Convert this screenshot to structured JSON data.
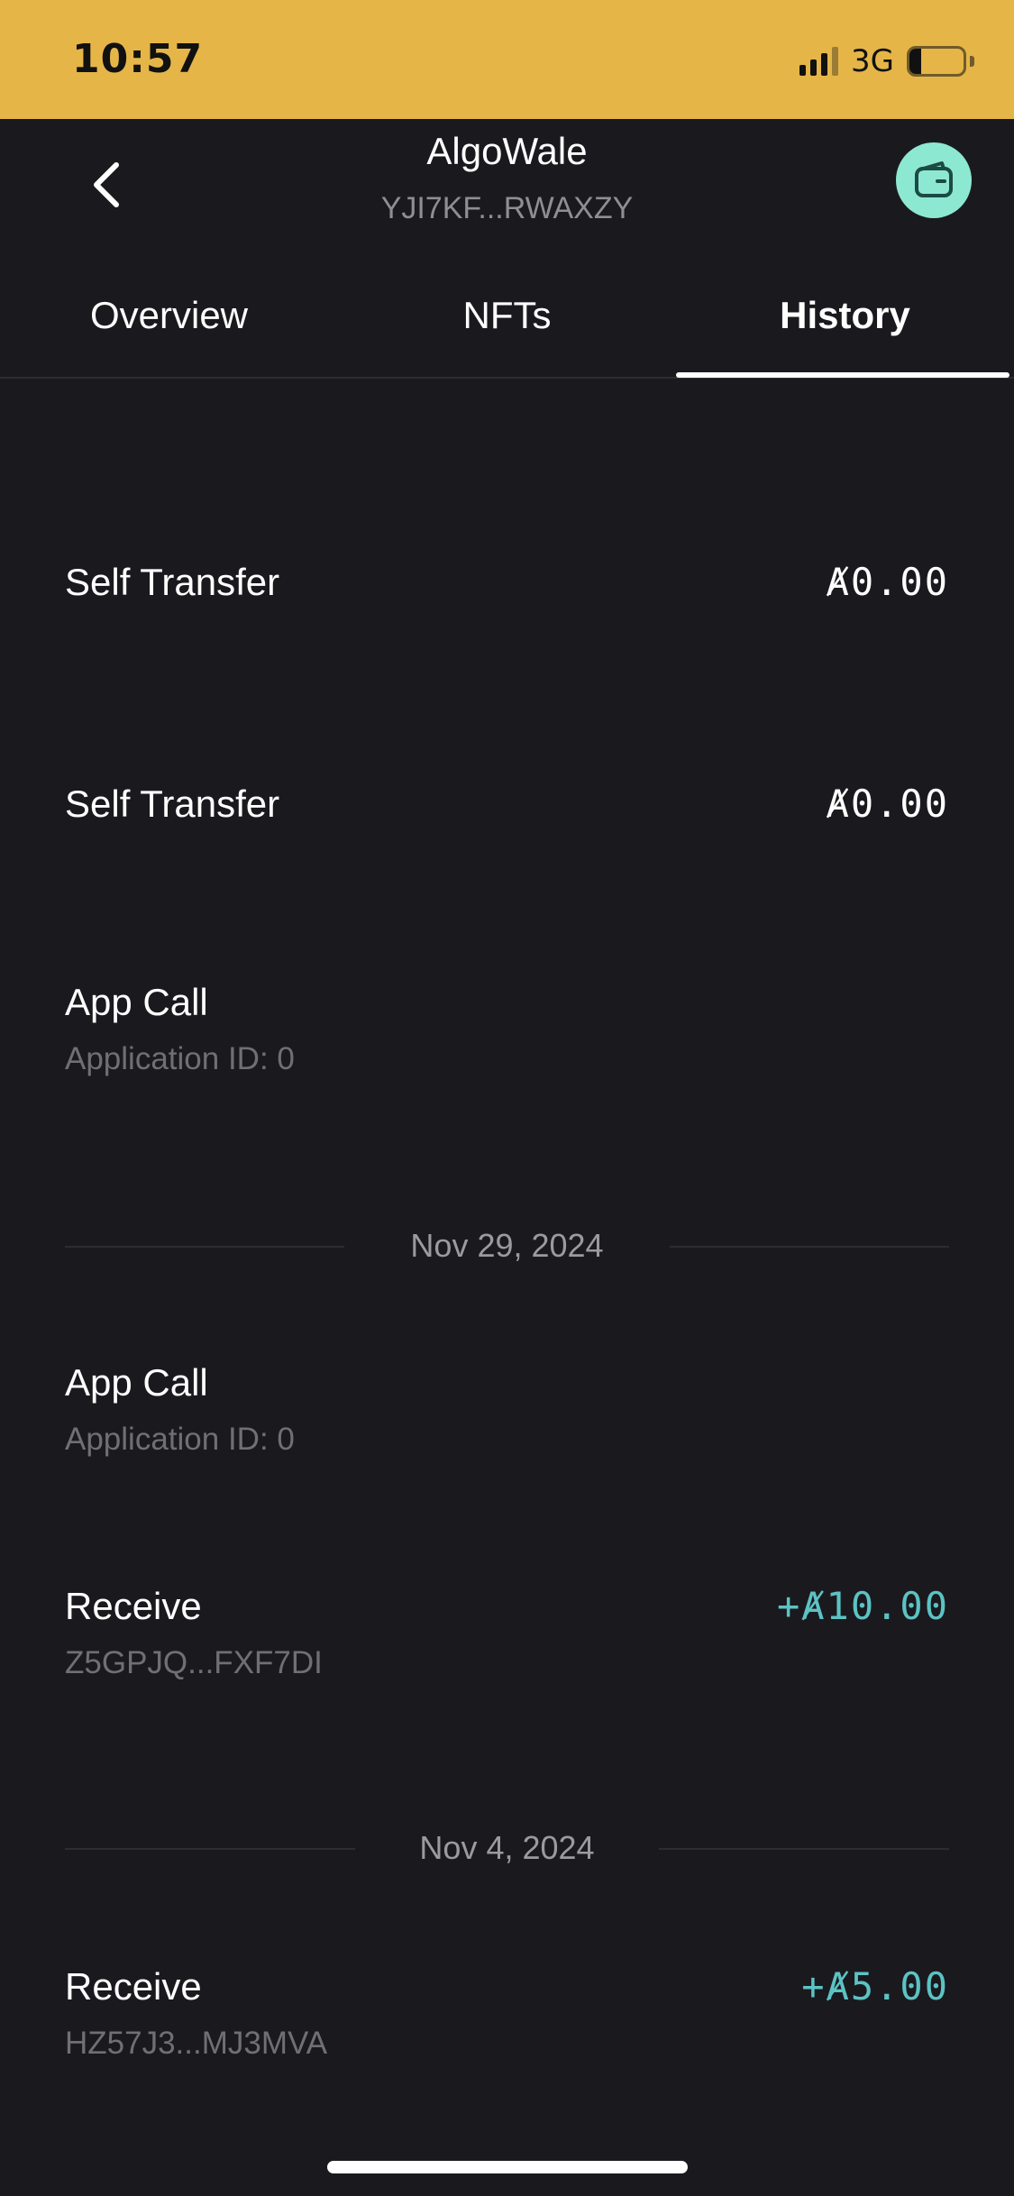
{
  "status_bar": {
    "time": "10:57",
    "network": "3G",
    "battery": "22",
    "battery_level": 0.22,
    "background_color": "#e5b548"
  },
  "header": {
    "title": "AlgoWale",
    "subtitle": "YJI7KF...RWAXZY",
    "back_icon": "chevron-left-icon",
    "wallet_icon": "wallet-icon",
    "wallet_button_color": "#8de8d2"
  },
  "tabs": [
    {
      "label": "Overview",
      "active": false
    },
    {
      "label": "NFTs",
      "active": false
    },
    {
      "label": "History",
      "active": true
    }
  ],
  "history": {
    "items": [
      {
        "title": "Self Transfer",
        "subtitle": "",
        "amount": "Ⱥ0.00"
      },
      {
        "title": "Self Transfer",
        "subtitle": "",
        "amount": "Ⱥ0.00"
      },
      {
        "title": "App Call",
        "subtitle": "Application ID: 0",
        "amount": ""
      },
      {
        "title": "App Call",
        "subtitle": "Application ID: 0",
        "amount": ""
      },
      {
        "title": "Receive",
        "subtitle": "Z5GPJQ...FXF7DI",
        "amount": "+Ⱥ10.00"
      },
      {
        "title": "Receive",
        "subtitle": "HZ57J3...MJ3MVA",
        "amount": "+Ⱥ5.00"
      }
    ],
    "dates": [
      "Nov 29, 2024",
      "Nov 4, 2024"
    ]
  },
  "colors": {
    "background": "#1a1a1e",
    "positive_amount": "#5cc3c4",
    "secondary_text": "#6f6f74"
  }
}
